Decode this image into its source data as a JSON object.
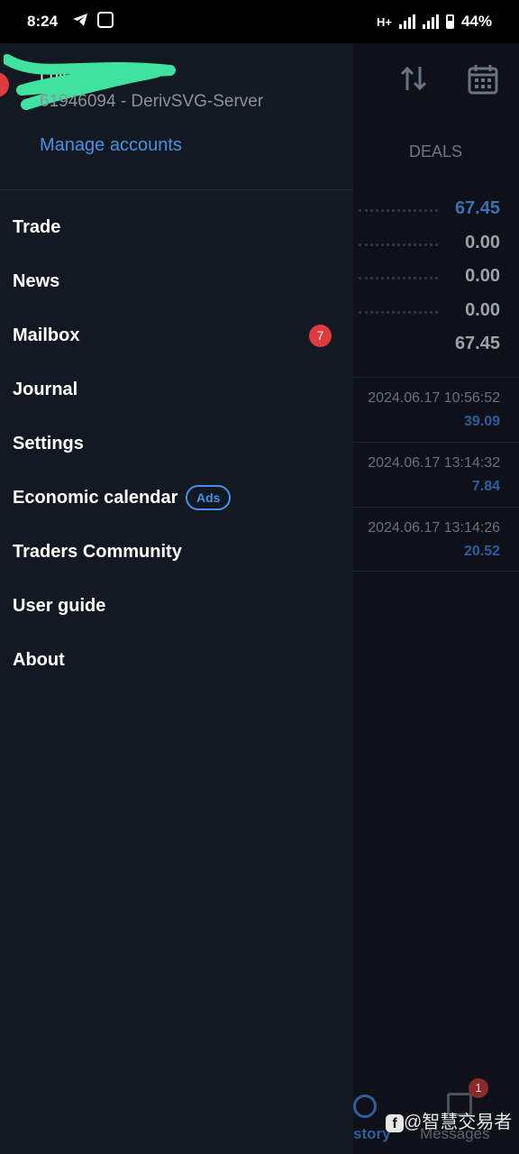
{
  "status_bar": {
    "time": "8:24",
    "network": "H+",
    "battery": "44%",
    "battery_level": 0.44
  },
  "account": {
    "name": "Luis ",
    "number_server": "61946094 - DerivSVG-Server",
    "manage_label": "Manage accounts"
  },
  "menu": {
    "items": [
      {
        "label": "Trade"
      },
      {
        "label": "News"
      },
      {
        "label": "Mailbox",
        "badge": "7"
      },
      {
        "label": "Journal"
      },
      {
        "label": "Settings"
      },
      {
        "label": "Economic calendar",
        "tag": "Ads"
      },
      {
        "label": "Traders Community"
      },
      {
        "label": "User guide"
      },
      {
        "label": "About"
      }
    ]
  },
  "background": {
    "tab": "DEALS",
    "summary": [
      "67.45",
      "0.00",
      "0.00",
      "0.00",
      "67.45"
    ],
    "deals": [
      {
        "date": "2024.06.17 10:56:52",
        "amount": "39.09"
      },
      {
        "date": "2024.06.17 13:14:32",
        "amount": "7.84"
      },
      {
        "date": "2024.06.17 13:14:26",
        "amount": "20.52"
      }
    ],
    "nav_history": "story",
    "nav_messages": "Messages",
    "messages_badge": "1"
  },
  "watermark": "@智慧交易者",
  "colors": {
    "accent": "#4a90e2",
    "badge": "#e0393e",
    "drawer_bg": "#131923"
  }
}
